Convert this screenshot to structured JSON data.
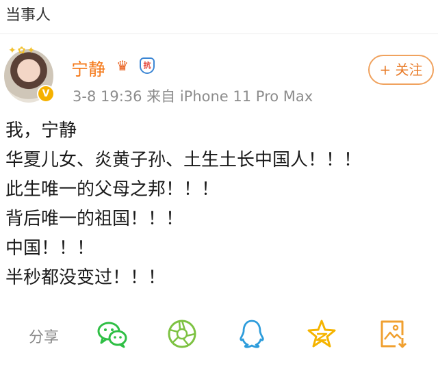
{
  "header": {
    "title": "当事人"
  },
  "user": {
    "name": "宁静",
    "verified_badge": "V",
    "badges": [
      "crown-icon",
      "shield-icon"
    ],
    "shield_text": "抗"
  },
  "meta": {
    "text": "3-8 19:36  来自 iPhone 11 Pro Max"
  },
  "follow_button": {
    "label": "+ 关注"
  },
  "post": {
    "lines": [
      "我，宁静",
      "华夏儿女、炎黄子孙、土生土长中国人！！！",
      "此生唯一的父母之邦！！！",
      "背后唯一的祖国！！！",
      "中国！！！",
      "半秒都没变过！！！"
    ]
  },
  "share": {
    "label": "分享",
    "targets": [
      "wechat-icon",
      "moments-icon",
      "qq-icon",
      "qzone-icon",
      "save-image-icon"
    ]
  },
  "colors": {
    "accent": "#f57a1b",
    "wechat": "#2fbf45",
    "moments": "#7dc242",
    "qq": "#2d9cdb",
    "qzone": "#f5b400",
    "save": "#f0a030"
  }
}
